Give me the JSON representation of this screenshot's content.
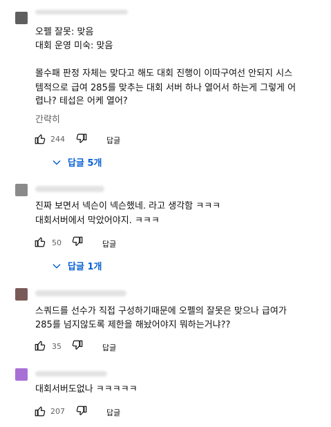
{
  "comments": [
    {
      "avatar_color": "#5f5f5f",
      "lines": [
        "오펠 잘못: 맞음",
        "대회 운영 미숙: 맞음",
        "",
        "몰수패 판정 자체는 맞다고 해도 대회 진행이 이따구여선 안되지 시스",
        "템적으로 급여 285를 맞추는 대회 서버 하나 열어서 하는게 그렇게 어",
        "렵나? 테섭은 어케 열어?"
      ],
      "collapse_label": "간략히",
      "likes": "244",
      "reply_label": "답글",
      "replies_label": "답글 5개"
    },
    {
      "avatar_color": "#8a8a8a",
      "lines": [
        "진짜 보면서 넥슨이 넥슨했네. 라고 생각함 ㅋㅋㅋ",
        "대회서버에서 막았어야지. ㅋㅋㅋ"
      ],
      "likes": "50",
      "reply_label": "답글",
      "replies_label": "답글 1개"
    },
    {
      "avatar_color": "#7a5a58",
      "lines": [
        "스쿼드를 선수가 직접 구성하기때문에 오펠의 잘못은 맞으나 급여가",
        "285를 넘지않도록 제한을 해놨어야지 뭐하는거냐??"
      ],
      "likes": "35",
      "reply_label": "답글"
    },
    {
      "avatar_color": "#a870d6",
      "lines": [
        "대회서버도없나 ㅋㅋㅋㅋㅋ"
      ],
      "likes": "207",
      "reply_label": "답글"
    }
  ],
  "icons": {
    "like": "thumbs-up-icon",
    "dislike": "thumbs-down-icon",
    "expand": "chevron-down-icon"
  },
  "accent_color": "#065fd4"
}
